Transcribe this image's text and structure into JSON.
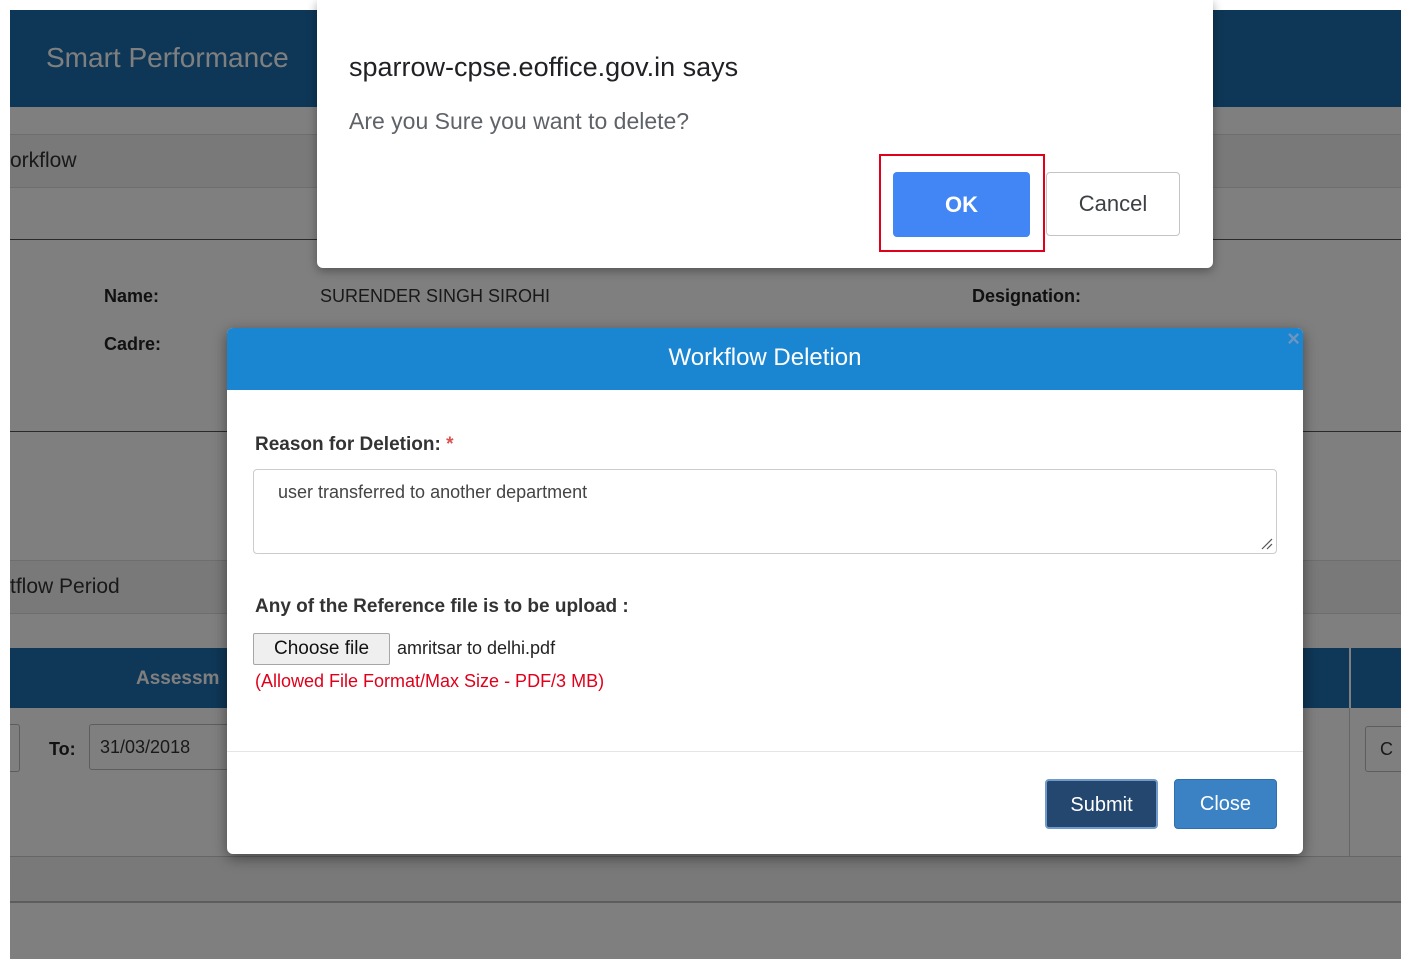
{
  "app": {
    "title": "Smart Performance",
    "workflow_strip": "orkflow",
    "period_strip": "tflow Period"
  },
  "profile": {
    "name_label": "Name:",
    "name_value": "SURENDER SINGH SIROHI",
    "designation_label": "Designation:",
    "cadre_label": "Cadre:"
  },
  "table": {
    "header_text": "Assessm",
    "to_label": "To:",
    "to_value": "31/03/2018",
    "right_value": "C"
  },
  "modal": {
    "title": "Workflow Deletion",
    "close_glyph": "×",
    "reason_label": "Reason for Deletion:",
    "required_mark": "*",
    "reason_value": "user transferred to another department",
    "upload_label": "Any of the Reference file is to be upload :",
    "choose_file_label": "Choose file",
    "file_name": "amritsar to delhi.pdf",
    "hint": "(Allowed File Format/Max Size - PDF/3 MB)",
    "submit_label": "Submit",
    "close_label": "Close"
  },
  "alert": {
    "title": "sparrow-cpse.eoffice.gov.in says",
    "message": "Are you Sure you want to delete?",
    "ok_label": "OK",
    "cancel_label": "Cancel"
  },
  "colors": {
    "header_blue": "#1d6fae",
    "modal_header_blue": "#1a85d1",
    "ok_blue": "#4285f4",
    "highlight_red": "#e0001b",
    "submit_navy": "#24476f",
    "close_blue": "#3a82c4"
  }
}
